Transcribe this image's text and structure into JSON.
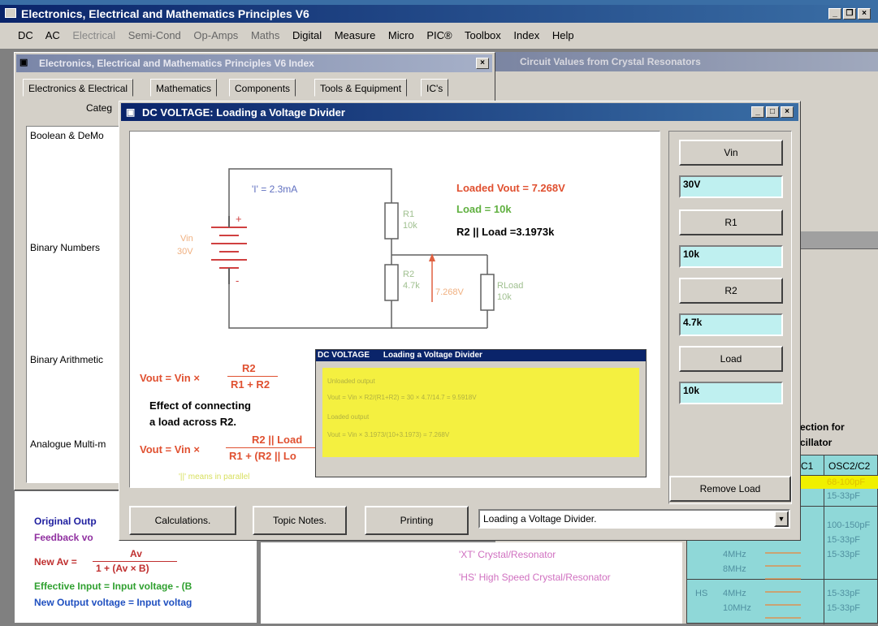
{
  "app": {
    "title": "Electronics, Electrical and Mathematics Principles V6",
    "menu": [
      "DC",
      "AC",
      "Electrical",
      "Semi-Cond",
      "Op-Amps",
      "Maths",
      "Digital",
      "Measure",
      "Micro",
      "PIC®",
      "Toolbox",
      "Index",
      "Help"
    ]
  },
  "index_window": {
    "title": "Electronics, Electrical and Mathematics Principles V6 Index",
    "tabs": [
      "Electronics & Electrical",
      "Mathematics",
      "Components",
      "Tools & Equipment",
      "IC's"
    ],
    "category_label": "Categ",
    "list": [
      "Boolean & DeMo",
      "Binary Numbers",
      "Binary Arithmetic",
      "Analogue Multi-m"
    ]
  },
  "bg_window2": {
    "title": "Circuit Values from Crystal Resonators"
  },
  "dc_window": {
    "title": "DC VOLTAGE:   Loading a Voltage Divider",
    "circuit": {
      "current": "'I' = 2.3mA",
      "vin_label": "Vin",
      "vin_value": "30V",
      "r1_label": "R1",
      "r1_value": "10k",
      "r2_label": "R2",
      "r2_value": "4.7k",
      "vout_mid": "7.268V",
      "rload_label": "RLoad",
      "rload_value": "10k"
    },
    "results": {
      "loaded_vout": "Loaded Vout = 7.268V",
      "load": "Load = 10k",
      "parallel": "R2 || Load =3.1973k"
    },
    "formula1": {
      "lhs": "Vout = Vin ×",
      "num": "R2",
      "den": "R1 + R2"
    },
    "effect_text": [
      "Effect of connecting",
      "a load across R2."
    ],
    "formula2": {
      "lhs": "Vout = Vin ×",
      "num": "R2 || Load",
      "den": "R1 + (R2 || Lo"
    },
    "footnote": "'||' means in parallel",
    "mini_window": {
      "title_a": "DC VOLTAGE",
      "title_b": "Loading a Voltage Divider",
      "lines": [
        "Unloaded output",
        "Vout = Vin × R2/(R1+R2) = 30 × 4.7/14.7 = 9.5918V",
        "Loaded output",
        "Vout = Vin × 3.1973/(10+3.1973) = 7.268V"
      ]
    },
    "right": {
      "vin_button": "Vin",
      "vin_field": "30V",
      "r1_button": "R1",
      "r1_field": "10k",
      "r2_button": "R2",
      "r2_field": "4.7k",
      "load_button": "Load",
      "load_field": "10k",
      "remove_button": "Remove Load"
    },
    "bottom": {
      "calc_button": "Calculations.",
      "topic_button": "Topic Notes.",
      "print_button": "Printing",
      "dropdown_value": "Loading a Voltage Divider."
    }
  },
  "bottom_left": {
    "lines": [
      "Original Outp",
      "Feedback vo",
      "New Av =",
      "Effective Input = Input voltage - (B",
      "New Output voltage = Input voltag"
    ],
    "av_num": "Av",
    "av_den": "1 + (Av × B)"
  },
  "bottom_mid": {
    "lines": [
      "'XT' Crystal/Resonator",
      "'HS' High Speed Crystal/Resonator"
    ]
  },
  "right_table": {
    "caption": [
      "ection for",
      "cillator"
    ],
    "headers": [
      "C1",
      "OSC2/C2"
    ],
    "rows": [
      [
        "",
        "68-100pF"
      ],
      [
        "",
        "15-33pF"
      ],
      [
        "",
        "100-150pF"
      ],
      [
        "",
        "15-33pF"
      ],
      [
        "",
        "15-33pF"
      ],
      [
        "",
        "15-33pF"
      ],
      [
        "",
        "15-33pF"
      ]
    ],
    "mid_cells": [
      "4MHz",
      "8MHz",
      "4MHz",
      "10MHz"
    ],
    "hs_label": "HS"
  }
}
